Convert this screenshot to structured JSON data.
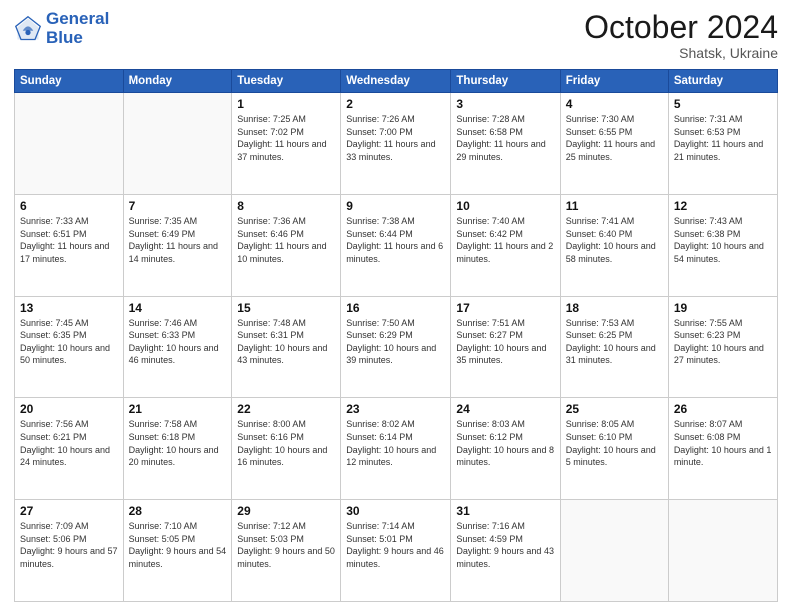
{
  "logo": {
    "line1": "General",
    "line2": "Blue"
  },
  "title": "October 2024",
  "subtitle": "Shatsk, Ukraine",
  "days_of_week": [
    "Sunday",
    "Monday",
    "Tuesday",
    "Wednesday",
    "Thursday",
    "Friday",
    "Saturday"
  ],
  "weeks": [
    [
      {
        "day": "",
        "sunrise": "",
        "sunset": "",
        "daylight": ""
      },
      {
        "day": "",
        "sunrise": "",
        "sunset": "",
        "daylight": ""
      },
      {
        "day": "1",
        "sunrise": "Sunrise: 7:25 AM",
        "sunset": "Sunset: 7:02 PM",
        "daylight": "Daylight: 11 hours and 37 minutes."
      },
      {
        "day": "2",
        "sunrise": "Sunrise: 7:26 AM",
        "sunset": "Sunset: 7:00 PM",
        "daylight": "Daylight: 11 hours and 33 minutes."
      },
      {
        "day": "3",
        "sunrise": "Sunrise: 7:28 AM",
        "sunset": "Sunset: 6:58 PM",
        "daylight": "Daylight: 11 hours and 29 minutes."
      },
      {
        "day": "4",
        "sunrise": "Sunrise: 7:30 AM",
        "sunset": "Sunset: 6:55 PM",
        "daylight": "Daylight: 11 hours and 25 minutes."
      },
      {
        "day": "5",
        "sunrise": "Sunrise: 7:31 AM",
        "sunset": "Sunset: 6:53 PM",
        "daylight": "Daylight: 11 hours and 21 minutes."
      }
    ],
    [
      {
        "day": "6",
        "sunrise": "Sunrise: 7:33 AM",
        "sunset": "Sunset: 6:51 PM",
        "daylight": "Daylight: 11 hours and 17 minutes."
      },
      {
        "day": "7",
        "sunrise": "Sunrise: 7:35 AM",
        "sunset": "Sunset: 6:49 PM",
        "daylight": "Daylight: 11 hours and 14 minutes."
      },
      {
        "day": "8",
        "sunrise": "Sunrise: 7:36 AM",
        "sunset": "Sunset: 6:46 PM",
        "daylight": "Daylight: 11 hours and 10 minutes."
      },
      {
        "day": "9",
        "sunrise": "Sunrise: 7:38 AM",
        "sunset": "Sunset: 6:44 PM",
        "daylight": "Daylight: 11 hours and 6 minutes."
      },
      {
        "day": "10",
        "sunrise": "Sunrise: 7:40 AM",
        "sunset": "Sunset: 6:42 PM",
        "daylight": "Daylight: 11 hours and 2 minutes."
      },
      {
        "day": "11",
        "sunrise": "Sunrise: 7:41 AM",
        "sunset": "Sunset: 6:40 PM",
        "daylight": "Daylight: 10 hours and 58 minutes."
      },
      {
        "day": "12",
        "sunrise": "Sunrise: 7:43 AM",
        "sunset": "Sunset: 6:38 PM",
        "daylight": "Daylight: 10 hours and 54 minutes."
      }
    ],
    [
      {
        "day": "13",
        "sunrise": "Sunrise: 7:45 AM",
        "sunset": "Sunset: 6:35 PM",
        "daylight": "Daylight: 10 hours and 50 minutes."
      },
      {
        "day": "14",
        "sunrise": "Sunrise: 7:46 AM",
        "sunset": "Sunset: 6:33 PM",
        "daylight": "Daylight: 10 hours and 46 minutes."
      },
      {
        "day": "15",
        "sunrise": "Sunrise: 7:48 AM",
        "sunset": "Sunset: 6:31 PM",
        "daylight": "Daylight: 10 hours and 43 minutes."
      },
      {
        "day": "16",
        "sunrise": "Sunrise: 7:50 AM",
        "sunset": "Sunset: 6:29 PM",
        "daylight": "Daylight: 10 hours and 39 minutes."
      },
      {
        "day": "17",
        "sunrise": "Sunrise: 7:51 AM",
        "sunset": "Sunset: 6:27 PM",
        "daylight": "Daylight: 10 hours and 35 minutes."
      },
      {
        "day": "18",
        "sunrise": "Sunrise: 7:53 AM",
        "sunset": "Sunset: 6:25 PM",
        "daylight": "Daylight: 10 hours and 31 minutes."
      },
      {
        "day": "19",
        "sunrise": "Sunrise: 7:55 AM",
        "sunset": "Sunset: 6:23 PM",
        "daylight": "Daylight: 10 hours and 27 minutes."
      }
    ],
    [
      {
        "day": "20",
        "sunrise": "Sunrise: 7:56 AM",
        "sunset": "Sunset: 6:21 PM",
        "daylight": "Daylight: 10 hours and 24 minutes."
      },
      {
        "day": "21",
        "sunrise": "Sunrise: 7:58 AM",
        "sunset": "Sunset: 6:18 PM",
        "daylight": "Daylight: 10 hours and 20 minutes."
      },
      {
        "day": "22",
        "sunrise": "Sunrise: 8:00 AM",
        "sunset": "Sunset: 6:16 PM",
        "daylight": "Daylight: 10 hours and 16 minutes."
      },
      {
        "day": "23",
        "sunrise": "Sunrise: 8:02 AM",
        "sunset": "Sunset: 6:14 PM",
        "daylight": "Daylight: 10 hours and 12 minutes."
      },
      {
        "day": "24",
        "sunrise": "Sunrise: 8:03 AM",
        "sunset": "Sunset: 6:12 PM",
        "daylight": "Daylight: 10 hours and 8 minutes."
      },
      {
        "day": "25",
        "sunrise": "Sunrise: 8:05 AM",
        "sunset": "Sunset: 6:10 PM",
        "daylight": "Daylight: 10 hours and 5 minutes."
      },
      {
        "day": "26",
        "sunrise": "Sunrise: 8:07 AM",
        "sunset": "Sunset: 6:08 PM",
        "daylight": "Daylight: 10 hours and 1 minute."
      }
    ],
    [
      {
        "day": "27",
        "sunrise": "Sunrise: 7:09 AM",
        "sunset": "Sunset: 5:06 PM",
        "daylight": "Daylight: 9 hours and 57 minutes."
      },
      {
        "day": "28",
        "sunrise": "Sunrise: 7:10 AM",
        "sunset": "Sunset: 5:05 PM",
        "daylight": "Daylight: 9 hours and 54 minutes."
      },
      {
        "day": "29",
        "sunrise": "Sunrise: 7:12 AM",
        "sunset": "Sunset: 5:03 PM",
        "daylight": "Daylight: 9 hours and 50 minutes."
      },
      {
        "day": "30",
        "sunrise": "Sunrise: 7:14 AM",
        "sunset": "Sunset: 5:01 PM",
        "daylight": "Daylight: 9 hours and 46 minutes."
      },
      {
        "day": "31",
        "sunrise": "Sunrise: 7:16 AM",
        "sunset": "Sunset: 4:59 PM",
        "daylight": "Daylight: 9 hours and 43 minutes."
      },
      {
        "day": "",
        "sunrise": "",
        "sunset": "",
        "daylight": ""
      },
      {
        "day": "",
        "sunrise": "",
        "sunset": "",
        "daylight": ""
      }
    ]
  ]
}
